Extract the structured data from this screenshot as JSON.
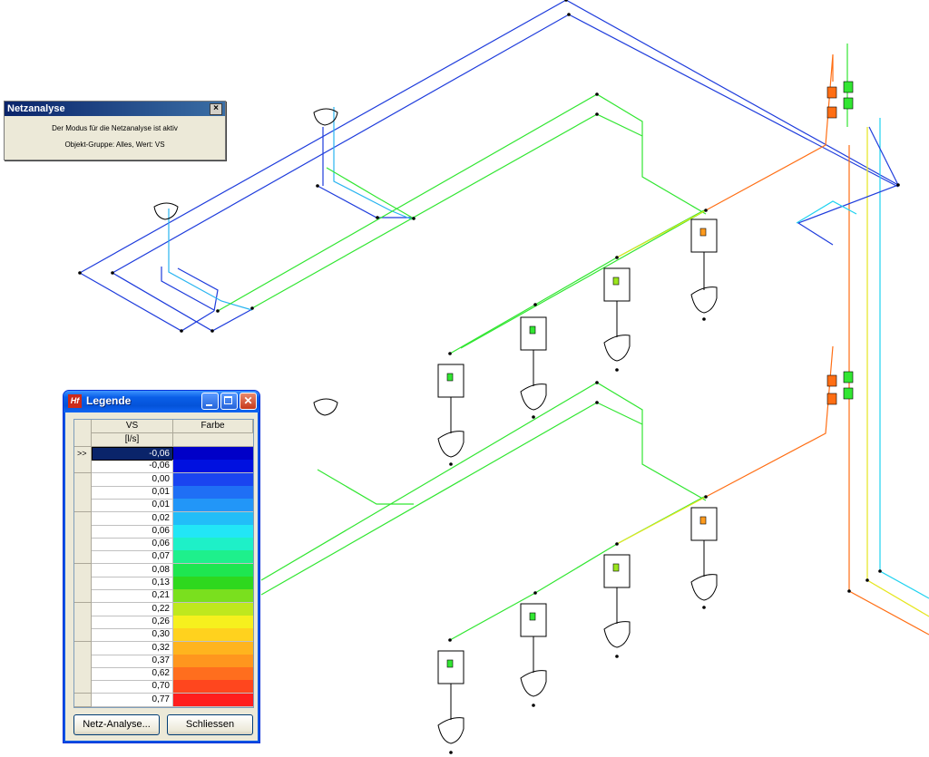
{
  "netz_window": {
    "title": "Netzanalyse",
    "close_glyph": "×",
    "line1": "Der Modus für die Netzanalyse ist aktiv",
    "line2": "Objekt-Gruppe: Alles, Wert: VS"
  },
  "legend_window": {
    "title": "Legende",
    "logo_text": "Hf",
    "col_value": "VS",
    "col_color": "Farbe",
    "unit": "[l/s]",
    "row_marker": ">>",
    "rows": [
      {
        "value": "-0,06",
        "color": "#0000c8"
      },
      {
        "value": "-0,06",
        "color": "#0010e0"
      },
      {
        "value": "0,00",
        "color": "#1a44f0"
      },
      {
        "value": "0,01",
        "color": "#1f6ff5"
      },
      {
        "value": "0,01",
        "color": "#2296f8"
      },
      {
        "value": "0,02",
        "color": "#22bdf8"
      },
      {
        "value": "0,06",
        "color": "#22e6f6"
      },
      {
        "value": "0,06",
        "color": "#1ef0c8"
      },
      {
        "value": "0,07",
        "color": "#1ef08c"
      },
      {
        "value": "0,08",
        "color": "#1ee650"
      },
      {
        "value": "0,13",
        "color": "#2ed81e"
      },
      {
        "value": "0,21",
        "color": "#7ae01e"
      },
      {
        "value": "0,22",
        "color": "#bfe81e"
      },
      {
        "value": "0,26",
        "color": "#f6f01e"
      },
      {
        "value": "0,30",
        "color": "#ffd21e"
      },
      {
        "value": "0,32",
        "color": "#ffb41e"
      },
      {
        "value": "0,37",
        "color": "#ff961e"
      },
      {
        "value": "0,62",
        "color": "#ff6e1e"
      },
      {
        "value": "0,70",
        "color": "#ff461e"
      },
      {
        "value": "0,77",
        "color": "#ff1e1e"
      }
    ],
    "button_analysis": "Netz-Analyse...",
    "button_close": "Schliessen"
  },
  "colors": {
    "pipe_blue": "#1e3cdc",
    "pipe_lightblue": "#28b4f0",
    "pipe_green": "#32e632",
    "pipe_yellow": "#e6e61e",
    "pipe_orange": "#ff6e14",
    "pipe_cyan": "#1ed2f0"
  }
}
